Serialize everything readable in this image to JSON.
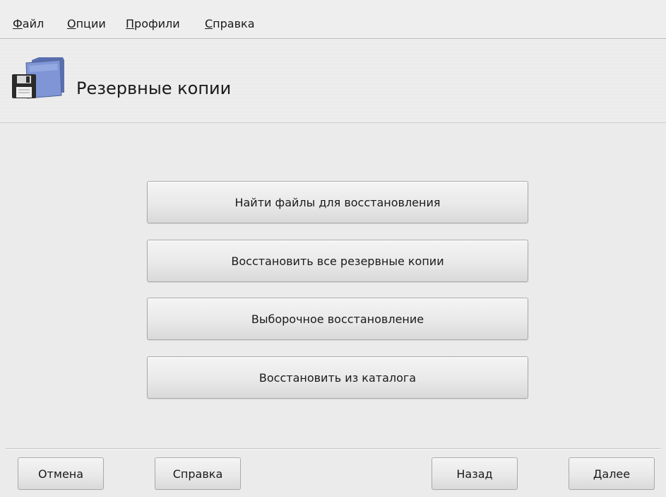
{
  "menubar": {
    "items": [
      {
        "first": "Ф",
        "rest": "айл"
      },
      {
        "first": "О",
        "rest": "пции"
      },
      {
        "first": "П",
        "rest": "рофили"
      },
      {
        "first": "С",
        "rest": "правка"
      }
    ]
  },
  "header": {
    "title": "Резервные копии",
    "icon": "floppy-folder-icon"
  },
  "actions": [
    {
      "label": "Найти файлы для восстановления"
    },
    {
      "label": "Восстановить все резервные копии"
    },
    {
      "label": "Выборочное восстановление"
    },
    {
      "label": "Восстановить из каталога"
    }
  ],
  "footer": {
    "cancel": "Отмена",
    "help": "Справка",
    "back": "Назад",
    "next": "Далее"
  }
}
